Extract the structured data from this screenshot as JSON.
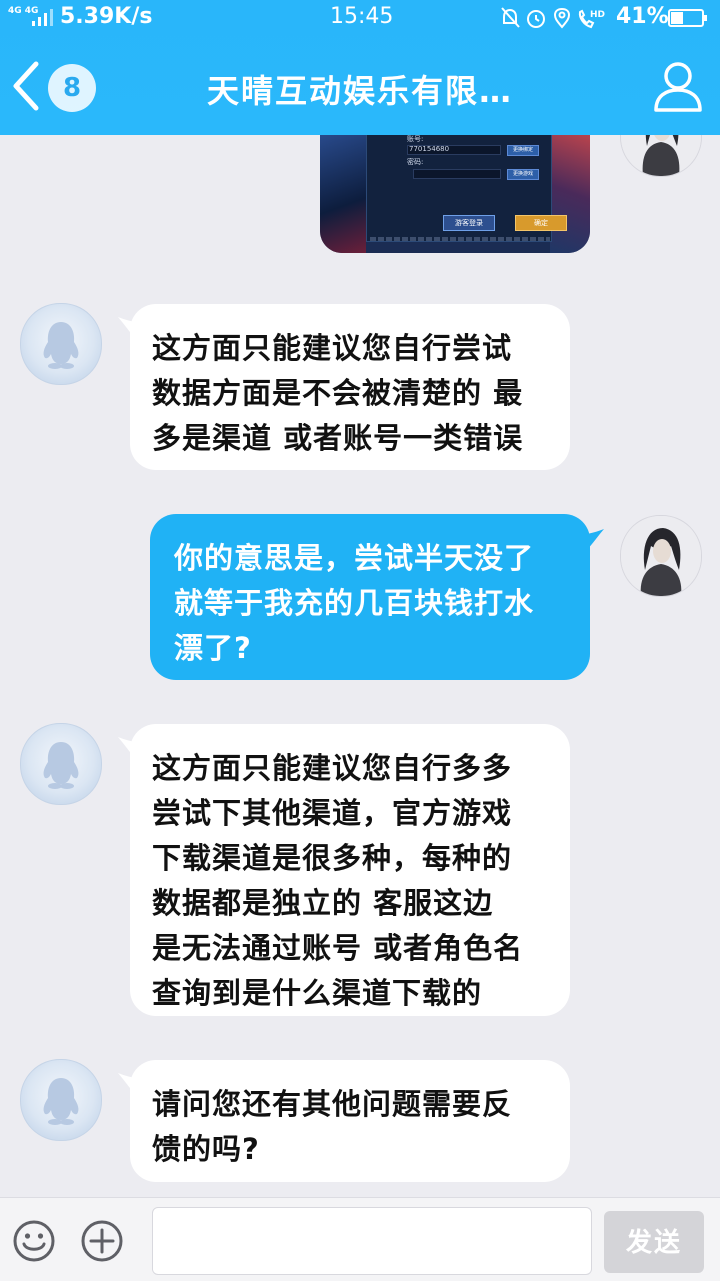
{
  "status_bar": {
    "network_type_1": "4G",
    "network_type_2": "4G",
    "net_speed": "5.39K/s",
    "time": "15:45",
    "battery_percent": "41%",
    "battery_level": 0.41,
    "icons": [
      "mute-icon",
      "alarm-icon",
      "location-icon",
      "hd-call-icon"
    ],
    "hd_label": "HD"
  },
  "header": {
    "unread_count": "8",
    "title": "天晴互动娱乐有限…",
    "accent_color": "#29b6fa"
  },
  "image_message": {
    "account_label": "账号:",
    "account_value": "770154680",
    "password_label": "密码:",
    "bind_button": "更换绑定",
    "switch_button": "更换游戏",
    "guest_login_button": "游客登录",
    "confirm_button": "确定"
  },
  "messages": [
    {
      "sender": "service",
      "text": "这方面只能建议您自行尝试\n数据方面是不会被清楚的 最\n多是渠道 或者账号一类错误"
    },
    {
      "sender": "me",
      "text": "你的意思是，尝试半天没了\n就等于我充的几百块钱打水\n漂了?"
    },
    {
      "sender": "service",
      "text": "这方面只能建议您自行多多\n尝试下其他渠道，官方游戏\n下载渠道是很多种，每种的\n数据都是独立的  客服这边\n是无法通过账号 或者角色名\n查询到是什么渠道下载的"
    },
    {
      "sender": "service",
      "text": "请问您还有其他问题需要反\n馈的吗?"
    }
  ],
  "input_bar": {
    "placeholder": "",
    "send_label": "发送"
  }
}
